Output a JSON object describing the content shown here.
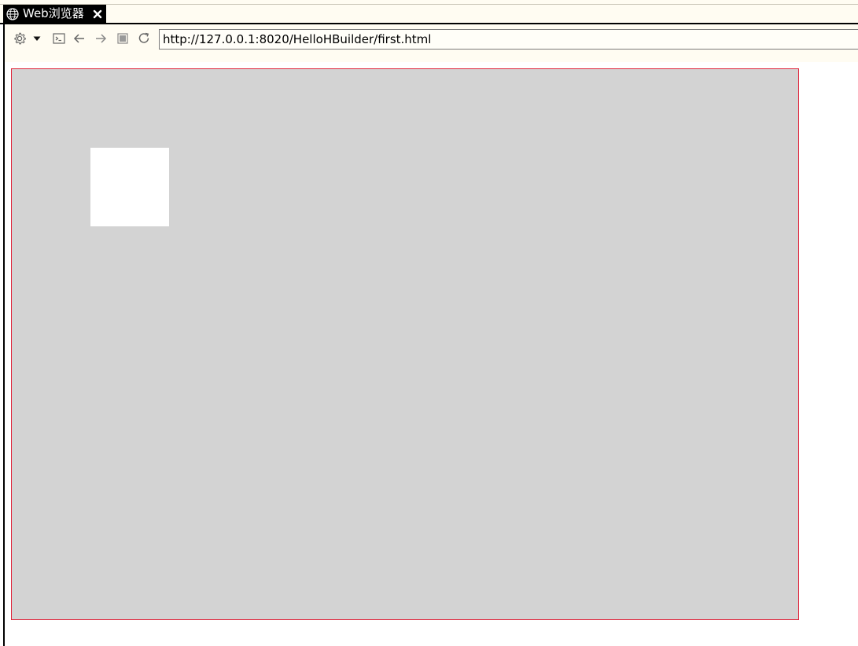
{
  "tab": {
    "title": "Web浏览器",
    "icon": "globe-icon",
    "close_icon": "close-icon"
  },
  "toolbar": {
    "icons": [
      "gear-icon",
      "dropdown-arrow-icon",
      "console-icon",
      "back-arrow-icon",
      "forward-arrow-icon",
      "stop-icon",
      "refresh-icon"
    ],
    "url": "http://127.0.0.1:8020/HelloHBuilder/first.html"
  },
  "colors": {
    "outer_box_bg": "#d3d3d3",
    "outer_box_border": "#e0233a",
    "inner_box_bg": "#ffffff",
    "chrome_bg": "#fffcf2"
  }
}
